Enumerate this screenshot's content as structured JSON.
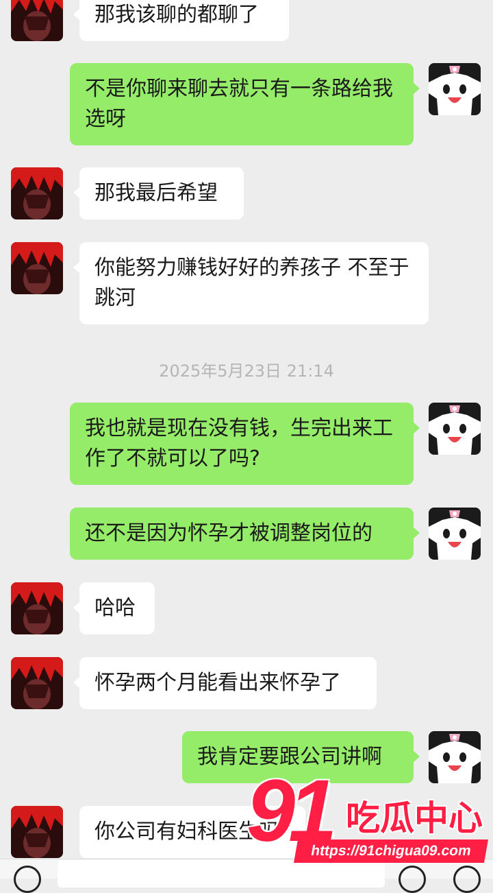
{
  "messages": [
    {
      "side": "in",
      "text": "那我该聊的都聊了"
    },
    {
      "side": "out",
      "text": "不是你聊来聊去就只有一条路给我选呀"
    },
    {
      "side": "in",
      "text": "那我最后希望"
    },
    {
      "side": "in",
      "text": "你能努力赚钱好好的养孩子 不至于跳河"
    },
    {
      "timestamp": "2025年5月23日 21:14"
    },
    {
      "side": "out",
      "text": "我也就是现在没有钱，生完出来工作了不就可以了吗?"
    },
    {
      "side": "out",
      "text": "还不是因为怀孕才被调整岗位的"
    },
    {
      "side": "in",
      "text": "哈哈"
    },
    {
      "side": "in",
      "text": "怀孕两个月能看出来怀孕了"
    },
    {
      "side": "out",
      "text": "我肯定要跟公司讲啊"
    },
    {
      "side": "in",
      "text": "你公司有妇科医生吗"
    }
  ],
  "avatars": {
    "contact": "red-haired-anime-avatar-icon",
    "self": "kuromi-avatar-icon"
  },
  "colors": {
    "background": "#ededed",
    "incoming_bubble": "#ffffff",
    "outgoing_bubble": "#95ec69",
    "watermark": "#ff1f44"
  },
  "watermark": {
    "number": "91",
    "title": "吃瓜中心",
    "url": "https://91chigua09.com"
  }
}
